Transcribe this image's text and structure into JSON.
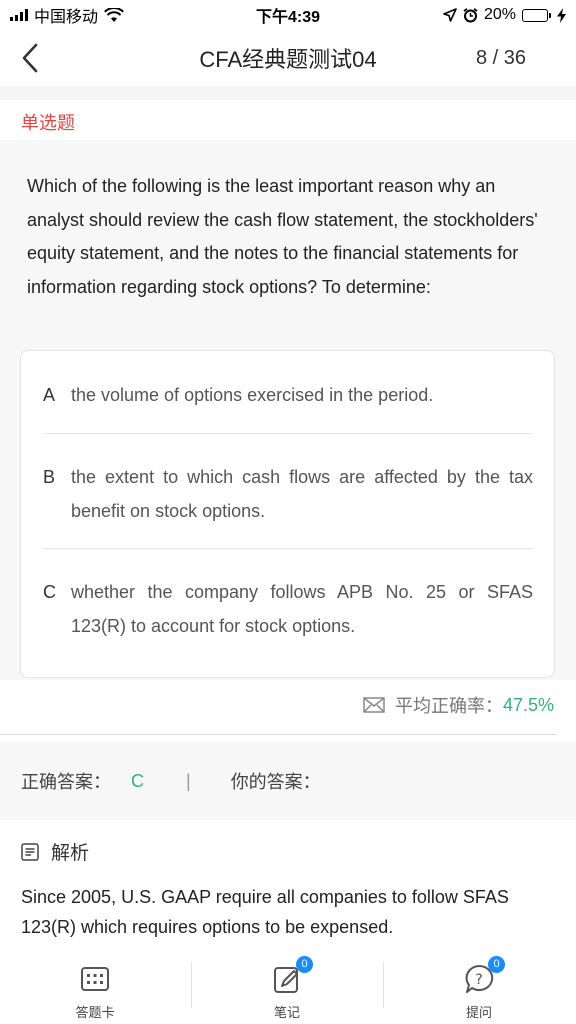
{
  "status": {
    "carrier": "中国移动",
    "time": "下午4:39",
    "battery_pct": "20%",
    "battery_level": 0.2,
    "icons": [
      "signal-icon",
      "wifi-icon",
      "location-icon",
      "alarm-icon",
      "battery-icon",
      "charging-icon"
    ]
  },
  "nav": {
    "back_icon": "chevron-left-icon",
    "title": "CFA经典题测试04",
    "progress": "8 / 36"
  },
  "question": {
    "type_label": "单选题",
    "text": "Which of the following is the least important reason why an analyst should review the cash flow statement, the stockholders' equity statement, and the notes to the financial statements for information regarding stock options? To determine:",
    "options": [
      {
        "letter": "A",
        "text": "the volume of options exercised in the period."
      },
      {
        "letter": "B",
        "text": "the extent to which cash flows are affected by the tax benefit on stock options."
      },
      {
        "letter": "C",
        "text": "whether the company follows APB No. 25 or SFAS 123(R) to account for stock options."
      }
    ]
  },
  "stats": {
    "label": "平均正确率：",
    "value": "47.5%"
  },
  "answers": {
    "correct_label": "正确答案：",
    "correct_value": "C",
    "separator": "|",
    "yours_label": "你的答案："
  },
  "analysis": {
    "heading": "解析",
    "text": "Since 2005, U.S. GAAP require all companies to follow SFAS 123(R) which requires options to be expensed."
  },
  "tabbar": {
    "items": [
      {
        "label": "答题卡",
        "icon": "answer-card-icon",
        "badge": ""
      },
      {
        "label": "笔记",
        "icon": "note-icon",
        "badge": "0"
      },
      {
        "label": "提问",
        "icon": "question-icon",
        "badge": "0"
      }
    ]
  },
  "colors": {
    "red": "#e64545",
    "green": "#2fb47f",
    "blue": "#1a8cff",
    "battery_yellow": "#f5c400"
  }
}
